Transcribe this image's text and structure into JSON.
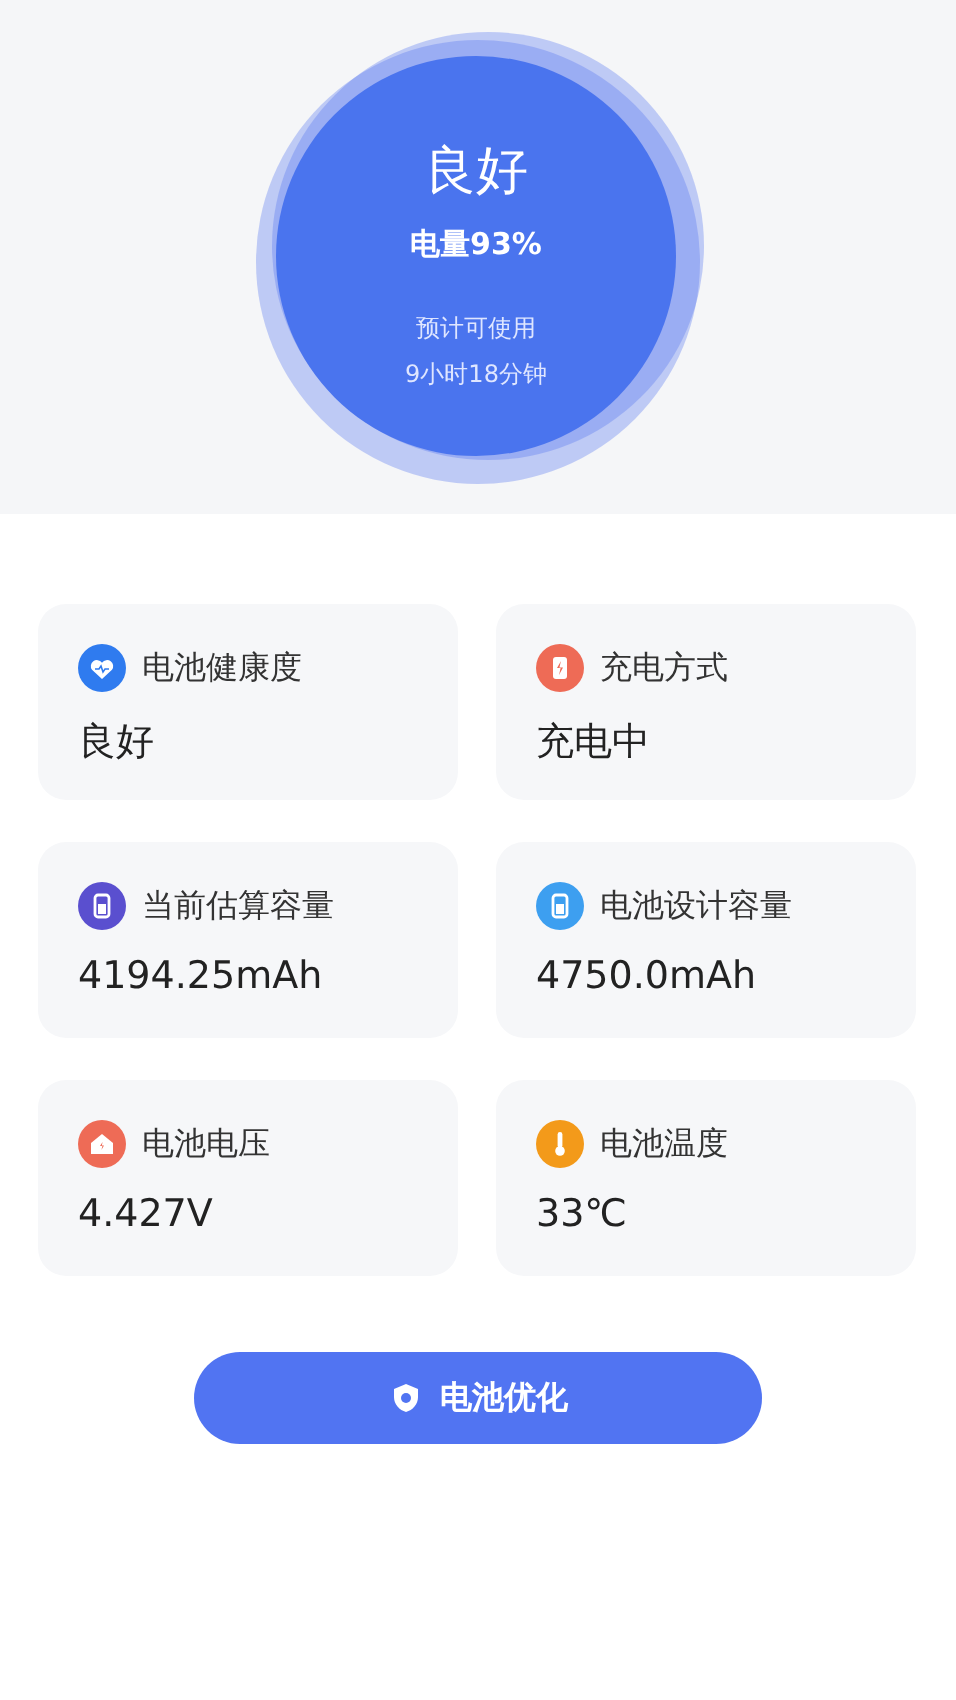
{
  "summary": {
    "status": "良好",
    "charge": "电量93%",
    "estimate_label": "预计可使用",
    "estimate": "9小时18分钟"
  },
  "cards": [
    {
      "label": "电池健康度",
      "value": "良好",
      "kind": "heart",
      "color": "#2f7bef"
    },
    {
      "label": "充电方式",
      "value": "充电中",
      "kind": "charge",
      "color": "#ee6b56"
    },
    {
      "label": "当前估算容量",
      "value": "4194.25mAh",
      "kind": "battery",
      "color": "#5a4fcf"
    },
    {
      "label": "电池设计容量",
      "value": "4750.0mAh",
      "kind": "battery",
      "color": "#3d9ff0"
    },
    {
      "label": "电池电压",
      "value": "4.427V",
      "kind": "home",
      "color": "#ee6b56"
    },
    {
      "label": "电池温度",
      "value": "33℃",
      "kind": "thermometer",
      "color": "#f39a1a"
    }
  ],
  "button": {
    "label": "电池优化"
  }
}
